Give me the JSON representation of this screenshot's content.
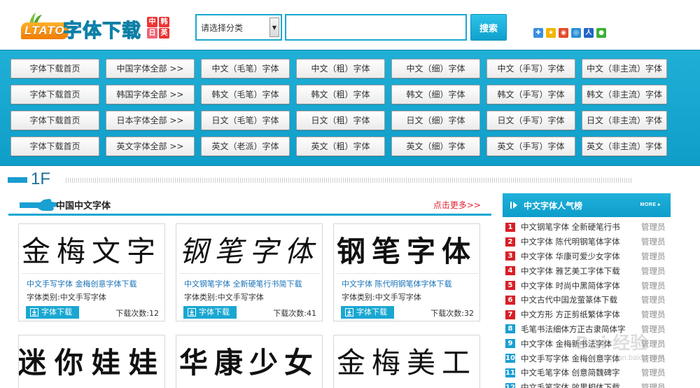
{
  "header": {
    "logo_latin": "LTATO",
    "logo_cn": "字体下载",
    "logo_tags": [
      "中",
      "韩",
      "日",
      "英"
    ],
    "select_text": "请选择分类",
    "search_value": "",
    "search_button": "搜索",
    "share_icons": [
      "qzone-share-icon",
      "star-share-icon",
      "weibo-share-icon",
      "tencent-share-icon",
      "renren-share-icon",
      "wechat-share-icon"
    ]
  },
  "nav": {
    "rows": [
      [
        "字体下载首页",
        "中国字体全部 >>",
        "中文（毛笔）字体",
        "中文（粗）字体",
        "中文（细）字体",
        "中文（手写）字体",
        "中文（非主流）字体"
      ],
      [
        "字体下载首页",
        "韩国字体全部 >>",
        "韩文（毛笔）字体",
        "韩文（粗）字体",
        "韩文（细）字体",
        "韩文（手写）字体",
        "韩文（非主流）字体"
      ],
      [
        "字体下载首页",
        "日本字体全部 >>",
        "日文（毛笔）字体",
        "日文（粗）字体",
        "日文（细）字体",
        "日文（手写）字体",
        "日文（非主流）字体"
      ],
      [
        "字体下载首页",
        "英文字体全部 >>",
        "英文（老派）字体",
        "英文（粗）字体",
        "英文（细）字体",
        "英文（手写）字体",
        "英文（非主流）字体"
      ]
    ]
  },
  "floor": {
    "label": "1F",
    "section_title": "中国中文字体",
    "more_link": "点击更多>>"
  },
  "cards": [
    {
      "preview": "金梅文字",
      "name": "中文手写字体 金梅创意字体下载",
      "category": "字体类别:中文手写字体",
      "download": "字体下载",
      "count": "下载次数:12"
    },
    {
      "preview": "钢笔字体",
      "name": "中文钢笔字体 全新硬笔行书简下载",
      "category": "字体类别:中文手写字体",
      "download": "字体下载",
      "count": "下载次数:41"
    },
    {
      "preview": "钢笔字体",
      "name": "中文字体 陈代明钢笔体字体下载",
      "category": "字体类别:中文手写字体",
      "download": "字体下载",
      "count": "下载次数:32"
    },
    {
      "preview": "迷你娃娃"
    },
    {
      "preview": "华康少女"
    },
    {
      "preview": "金梅美工"
    }
  ],
  "ranking": {
    "title": "中文字体人气榜",
    "more": "MORE ▸",
    "items": [
      {
        "num": "1",
        "name": "中文钢笔字体 全新硬笔行书",
        "author": "管理员"
      },
      {
        "num": "2",
        "name": "中文字体 陈代明钢笔体字体",
        "author": "管理员"
      },
      {
        "num": "3",
        "name": "中文字体 华康可爱少女字体",
        "author": "管理员"
      },
      {
        "num": "4",
        "name": "中文字体 雅艺美工字体下载",
        "author": "管理员"
      },
      {
        "num": "5",
        "name": "中文字体 时尚中黑简体字体",
        "author": "管理员"
      },
      {
        "num": "6",
        "name": "中文古代中国龙萤篆体下载",
        "author": "管理员"
      },
      {
        "num": "7",
        "name": "中文方形 方正剪纸繁体字体",
        "author": "管理员"
      },
      {
        "num": "8",
        "name": "毛笔书法细体方正古隶简体字",
        "author": "管理员"
      },
      {
        "num": "9",
        "name": "中文字体 金梅新书法字体",
        "author": "管理员"
      },
      {
        "num": "10",
        "name": "中文手写字体 金梅创意字体",
        "author": "管理员"
      },
      {
        "num": "11",
        "name": "中文毛笔字体 创意简魏碑字",
        "author": "管理员"
      },
      {
        "num": "12",
        "name": "中文毛笔字体 效果相体下载",
        "author": "管理员"
      }
    ]
  },
  "watermark": {
    "main": "Bai 经验",
    "sub": "jingyan.baidu.com"
  },
  "colors": {
    "accent": "#19a7d2",
    "rank_top": "#d81f26",
    "rank_rest": "#1a9fd3",
    "more_link": "#dd2233"
  }
}
